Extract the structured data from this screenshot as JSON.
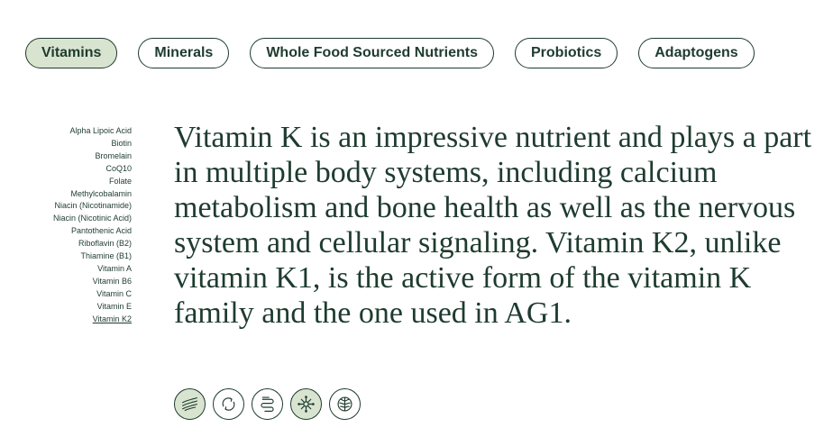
{
  "tabs": [
    {
      "label": "Vitamins",
      "active": true
    },
    {
      "label": "Minerals",
      "active": false
    },
    {
      "label": "Whole Food Sourced Nutrients",
      "active": false
    },
    {
      "label": "Probiotics",
      "active": false
    },
    {
      "label": "Adaptogens",
      "active": false
    }
  ],
  "sidebar": {
    "items": [
      "Alpha Lipoic Acid",
      "Biotin",
      "Bromelain",
      "CoQ10",
      "Folate",
      "Methylcobalamin",
      "Niacin (Nicotinamide)",
      "Niacin (Nicotinic Acid)",
      "Pantothenic Acid",
      "Riboflavin (B2)",
      "Thiamine (B1)",
      "Vitamin A",
      "Vitamin B6",
      "Vitamin C",
      "Vitamin E",
      "Vitamin K2"
    ],
    "selected": "Vitamin K2"
  },
  "main": {
    "description": "Vitamin K is an impressive nutrient and plays a part in multiple body systems, including calcium metabolism and bone health as well as the nervous system and cellular signaling. Vitamin K2, unlike vitamin K1, is the active form of the vitamin K family and the one used in AG1."
  },
  "benefit_icons": [
    {
      "name": "energy-waves-icon",
      "filled": true
    },
    {
      "name": "recovery-cycle-icon",
      "filled": false
    },
    {
      "name": "gut-health-icon",
      "filled": false
    },
    {
      "name": "immunity-virus-icon",
      "filled": true
    },
    {
      "name": "brain-health-icon",
      "filled": false
    }
  ],
  "colors": {
    "text": "#1e3b2f",
    "active_fill": "#d9e4d0",
    "background": "#ffffff"
  }
}
